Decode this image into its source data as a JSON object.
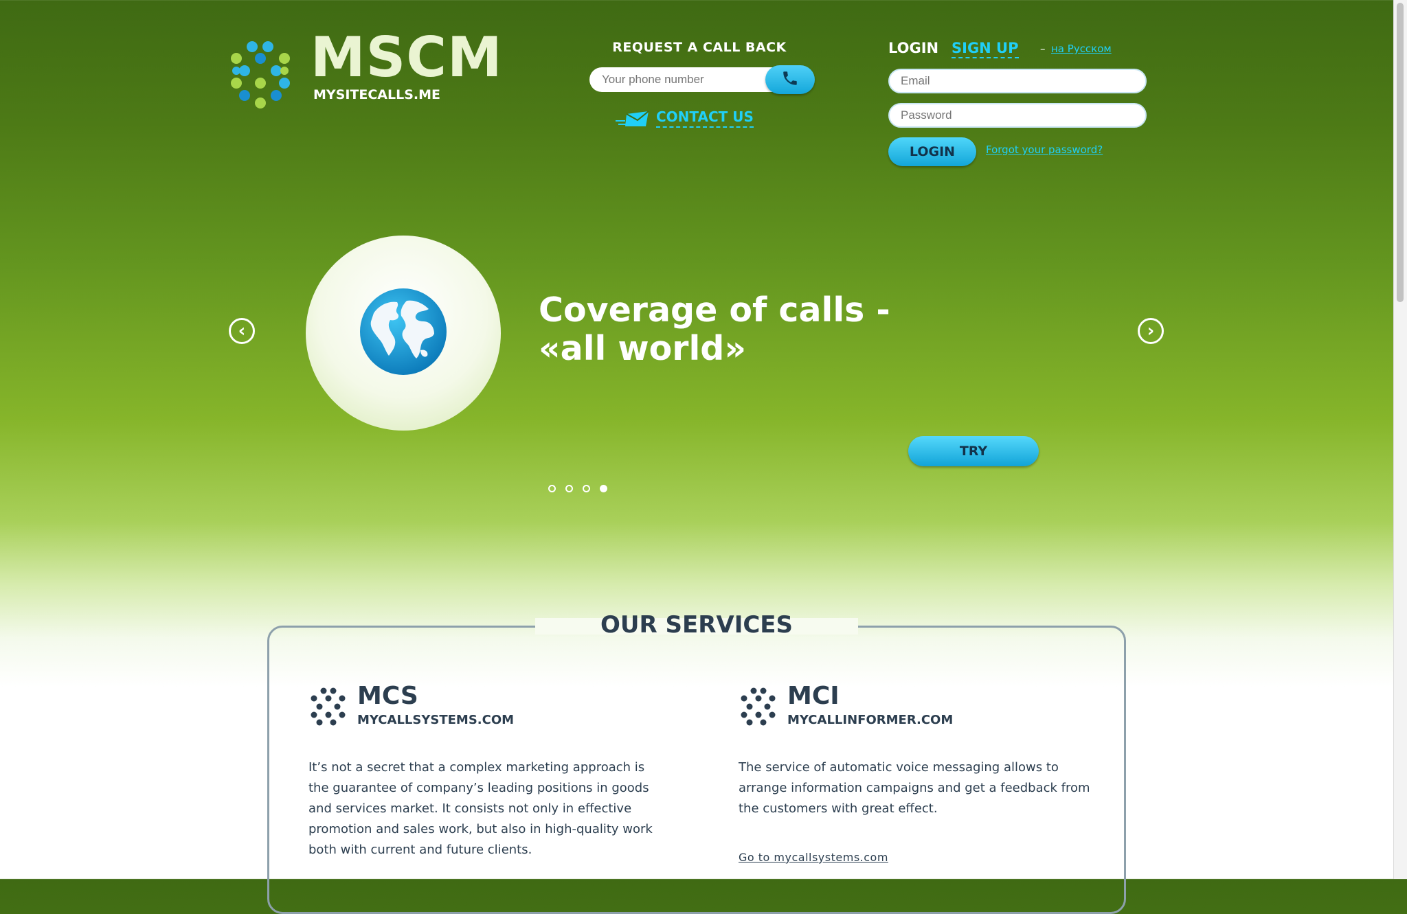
{
  "header": {
    "logo_title": "MSCM",
    "logo_subtitle": "MYSITECALLS.ME",
    "callback": {
      "title": "REQUEST A CALL BACK",
      "phone_placeholder": "Your phone number",
      "call_icon": "phone-icon",
      "contact_label": "CONTACT US",
      "contact_icon": "mail-icon"
    },
    "auth": {
      "login_tab": "LOGIN",
      "signup_tab": "SIGN UP",
      "lang_dash": "–",
      "lang_link": "на Русском",
      "email_placeholder": "Email",
      "password_placeholder": "Password",
      "login_button": "LOGIN",
      "forgot_link": "Forgot your password?"
    }
  },
  "slider": {
    "prev_icon": "chevron-left-icon",
    "next_icon": "chevron-right-icon",
    "prev_glyph": "‹",
    "next_glyph": "›",
    "slide_icon": "globe-icon",
    "title_line1": "Coverage of calls -",
    "title_line2": "«all world»",
    "try_button": "TRY",
    "dots_total": 4,
    "active_dot": 4
  },
  "services": {
    "title": "OUR SERVICES",
    "items": [
      {
        "name": "MCS",
        "domain": "MYCALLSYSTEMS.COM",
        "text": "It’s not a secret that a complex marketing approach is the guarantee of company’s leading positions in goods and services market. It consists not only in effective promotion and sales work, but also in high-quality work both with current and future clients."
      },
      {
        "name": "MCI",
        "domain": "MYCALLINFORMER.COM",
        "text": "The service of automatic voice messaging allows to arrange information campaigns and get a feedback from the customers with great effect.",
        "link": "Go to mycallsystems.com"
      }
    ]
  },
  "colors": {
    "accent": "#20cff7",
    "dark_text": "#2c3e4f",
    "green_top": "#3f6a13",
    "green_mid": "#86b52a"
  }
}
